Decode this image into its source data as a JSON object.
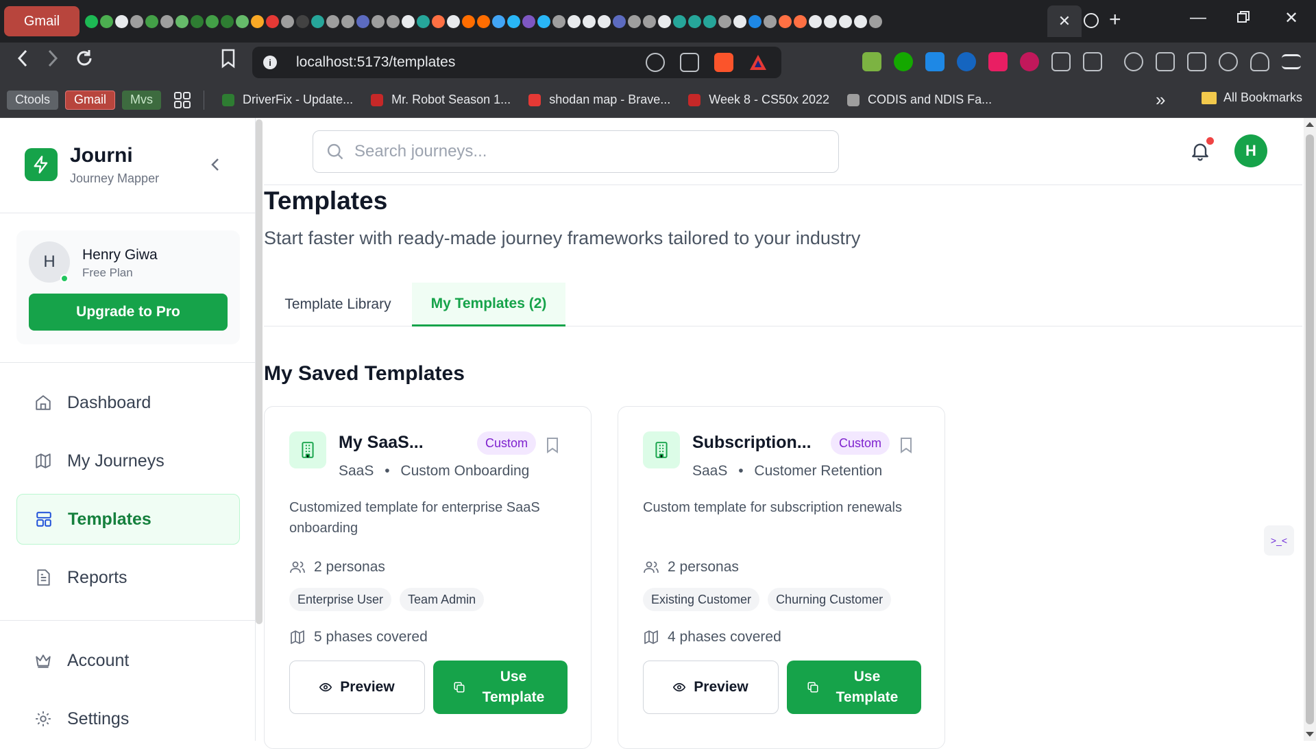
{
  "browser": {
    "pinned_tab_label": "Gmail",
    "active_tab_close": "✕",
    "new_tab": "+",
    "url": "localhost:5173/templates",
    "bookmarks": {
      "chips": [
        {
          "label": "Ctools",
          "bg": "#5f6368",
          "color": "#e8eaed"
        },
        {
          "label": "Gmail",
          "bg": "#b8453d",
          "color": "#ffffff"
        },
        {
          "label": "Mvs",
          "bg": "#3d6b3f",
          "color": "#c8e6c9"
        }
      ],
      "links": [
        {
          "label": "DriverFix - Update...",
          "color": "#2e7d32"
        },
        {
          "label": "Mr. Robot Season 1...",
          "color": "#c62828"
        },
        {
          "label": "shodan map - Brave...",
          "color": "#e53935"
        },
        {
          "label": "Week 8 - CS50x 2022",
          "color": "#c62828"
        },
        {
          "label": "CODIS and NDIS Fa...",
          "color": "#9e9e9e"
        }
      ],
      "overflow": "»",
      "all_bookmarks": "All Bookmarks"
    }
  },
  "sidebar": {
    "app_name": "Journi",
    "app_tagline": "Journey Mapper",
    "user": {
      "initial": "H",
      "name": "Henry Giwa",
      "plan": "Free Plan",
      "upgrade_label": "Upgrade to Pro"
    },
    "nav": [
      {
        "label": "Dashboard",
        "icon": "home-icon"
      },
      {
        "label": "My Journeys",
        "icon": "map-icon"
      },
      {
        "label": "Templates",
        "icon": "layout-icon",
        "active": true
      },
      {
        "label": "Reports",
        "icon": "file-text-icon"
      }
    ],
    "bottom_nav": [
      {
        "label": "Account",
        "icon": "crown-icon"
      },
      {
        "label": "Settings",
        "icon": "gear-icon"
      }
    ]
  },
  "topbar": {
    "search_placeholder": "Search journeys...",
    "avatar_initial": "H"
  },
  "page": {
    "title": "Templates",
    "subtitle": "Start faster with ready-made journey frameworks tailored to your industry",
    "tabs": [
      {
        "label": "Template Library",
        "active": false
      },
      {
        "label": "My Templates (2)",
        "active": true
      }
    ],
    "section_title": "My Saved Templates"
  },
  "templates": [
    {
      "title": "My SaaS...",
      "badge": "Custom",
      "industry": "SaaS",
      "category": "Custom Onboarding",
      "description": "Customized template for enterprise SaaS onboarding",
      "personas_label": "2 personas",
      "personas": [
        "Enterprise User",
        "Team Admin"
      ],
      "phases_label": "5 phases covered",
      "preview_label": "Preview",
      "use_label": "Use Template"
    },
    {
      "title": "Subscription...",
      "badge": "Custom",
      "industry": "SaaS",
      "category": "Customer Retention",
      "description": "Custom template for subscription renewals",
      "personas_label": "2 personas",
      "personas": [
        "Existing Customer",
        "Churning Customer"
      ],
      "phases_label": "4 phases covered",
      "preview_label": "Preview",
      "use_label": "Use Template"
    }
  ],
  "colors": {
    "brand": "#16a34a",
    "badge_bg": "#f3e8ff",
    "badge_text": "#7e22ce",
    "notification": "#ef4444"
  }
}
